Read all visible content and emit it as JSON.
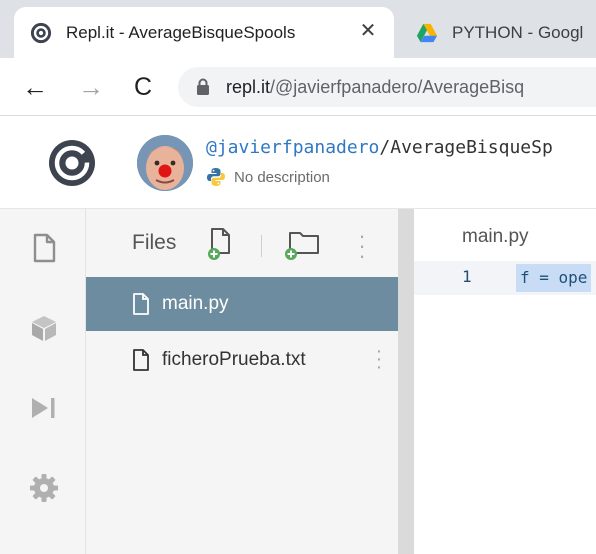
{
  "browser": {
    "tabs": [
      {
        "title": "Repl.it - AverageBisqueSpools",
        "close": "✕",
        "active": true
      },
      {
        "title": "PYTHON - Googl",
        "active": false
      }
    ],
    "nav": {
      "back": "←",
      "forward": "→",
      "reload": "C"
    },
    "address": {
      "host": "repl.it",
      "path": "/@javierfpanadero/AverageBisq"
    }
  },
  "repl": {
    "owner": "@javierfpanadero",
    "separator": "/",
    "name": "AverageBisqueSp",
    "description": "No description"
  },
  "files_panel": {
    "title": "Files",
    "items": [
      {
        "name": "main.py",
        "selected": true
      },
      {
        "name": "ficheroPrueba.txt",
        "selected": false
      }
    ]
  },
  "editor": {
    "tab": "main.py",
    "lines": [
      {
        "number": "1",
        "code": "f = ope"
      }
    ]
  },
  "colors": {
    "selected_row": "#6e8c9f",
    "owner_link": "#2f78c4",
    "code_highlight": "#c8ddf5"
  }
}
